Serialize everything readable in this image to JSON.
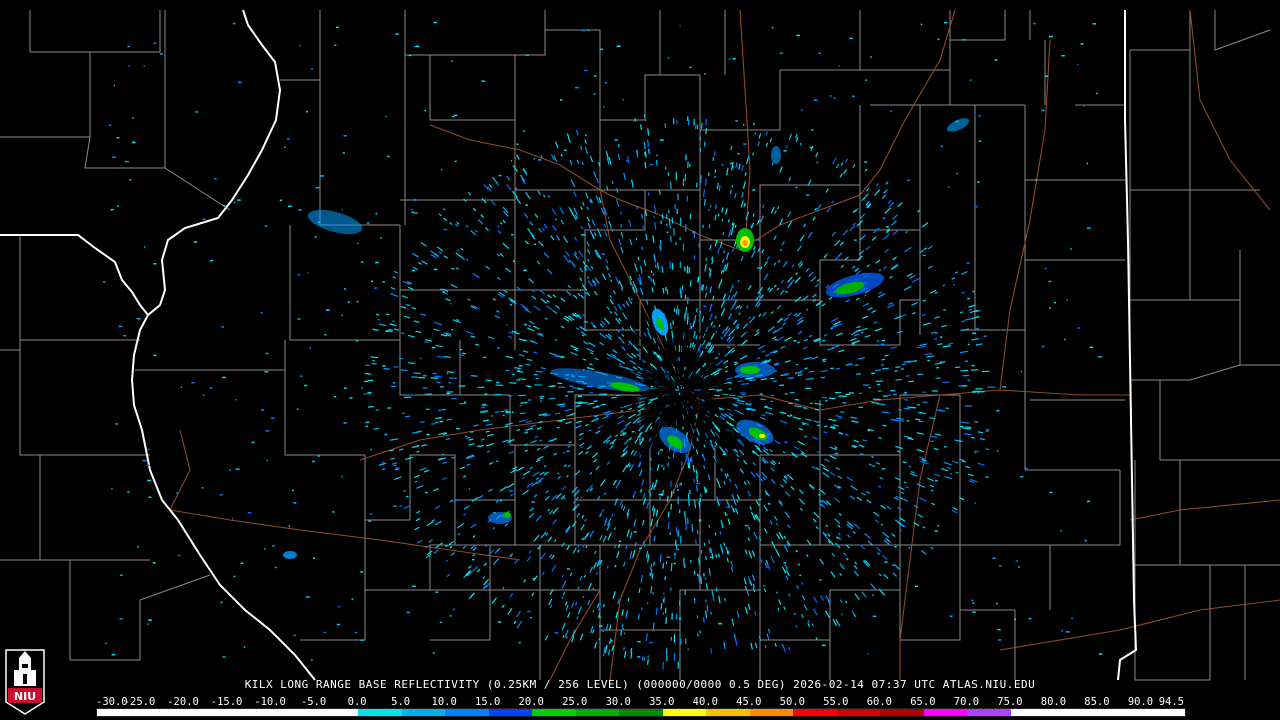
{
  "product_caption": "KILX LONG RANGE BASE REFLECTIVITY (0.25KM / 256 LEVEL) (000000/0000 0.5 DEG) 2026-02-14 07:37 UTC  ATLAS.NIU.EDU",
  "logo": {
    "text": "NIU",
    "icon": "niu-clock-tower-icon",
    "color": "#c8102e"
  },
  "colors": {
    "background": "#000000",
    "state_border": "#ffffff",
    "county_border": "#8a8a8a",
    "highway": "#a0522d"
  },
  "scale": {
    "labels": [
      "-30.0",
      "-25.0",
      "-20.0",
      "-15.0",
      "-10.0",
      "-5.0",
      "0.0",
      "5.0",
      "10.0",
      "15.0",
      "20.0",
      "25.0",
      "30.0",
      "35.0",
      "40.0",
      "45.0",
      "50.0",
      "55.0",
      "60.0",
      "65.0",
      "70.0",
      "75.0",
      "80.0",
      "85.0",
      "90.0",
      "94.5"
    ],
    "colors": [
      "#ffffff",
      "#ffffff",
      "#ffffff",
      "#ffffff",
      "#ffffff",
      "#ffffff",
      "#00e5ee",
      "#00b0f0",
      "#0080ff",
      "#0040ff",
      "#00d000",
      "#00b000",
      "#008c00",
      "#ffff00",
      "#ffc000",
      "#ff8c00",
      "#ff0000",
      "#d00000",
      "#b00000",
      "#ff00ff",
      "#b040ff",
      "#ffffff",
      "#ffffff",
      "#ffffff",
      "#ffffff"
    ]
  },
  "radar_site": "KILX"
}
